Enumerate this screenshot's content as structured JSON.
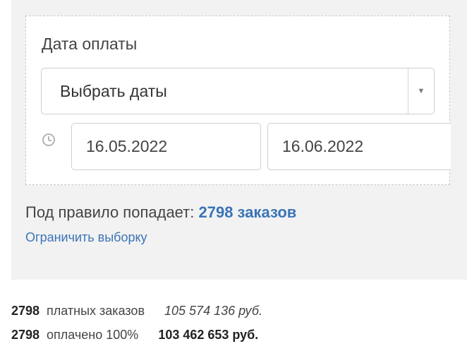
{
  "filter": {
    "field_label": "Дата оплаты",
    "select_value": "Выбрать даты",
    "date_from": "16.05.2022",
    "date_to": "16.06.2022"
  },
  "rule": {
    "prefix": "Под правило попадает:",
    "count_text": "2798 заказов",
    "limit_link": "Ограничить выборку"
  },
  "stats": [
    {
      "count": "2798",
      "label": "платных заказов",
      "sum": "105 574 136 руб."
    },
    {
      "count": "2798",
      "label": "оплачено 100%",
      "sum": "103 462 653 руб."
    }
  ],
  "colors": {
    "accent": "#3b74b8",
    "panel_bg": "#f2f2f2"
  }
}
